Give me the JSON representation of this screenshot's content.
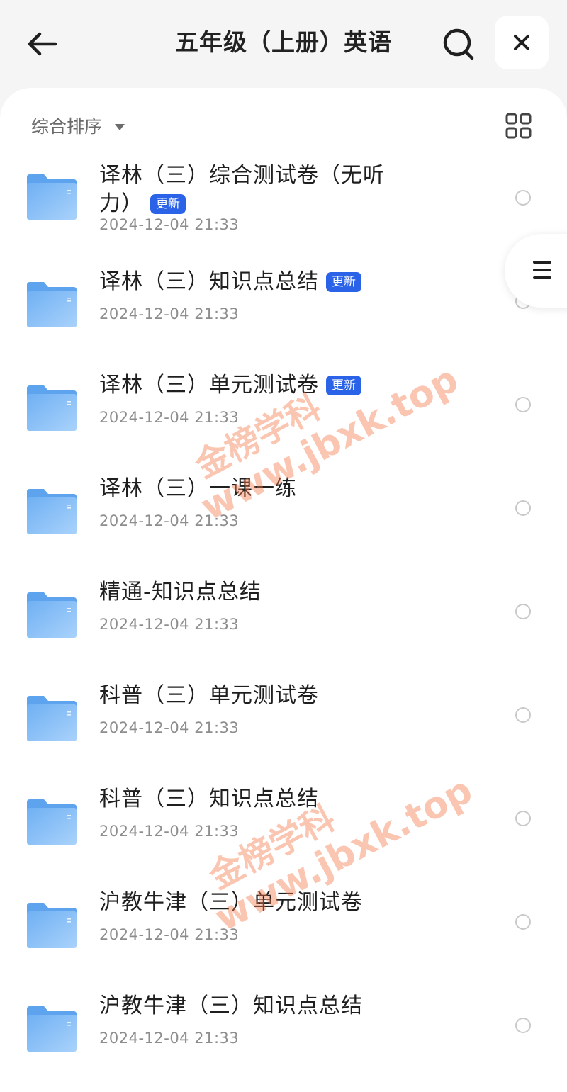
{
  "header": {
    "title": "五年级（上册）英语"
  },
  "toolbar": {
    "sort_label": "综合排序"
  },
  "items": [
    {
      "title": "译林（三）综合测试卷（无听力）",
      "badge": "更新",
      "date": "2024-12-04 21:33"
    },
    {
      "title": "译林（三）知识点总结",
      "badge": "更新",
      "date": "2024-12-04 21:33"
    },
    {
      "title": "译林（三）单元测试卷",
      "badge": "更新",
      "date": "2024-12-04 21:33"
    },
    {
      "title": "译林（三）一课一练",
      "badge": "",
      "date": "2024-12-04 21:33"
    },
    {
      "title": "精通-知识点总结",
      "badge": "",
      "date": "2024-12-04 21:33"
    },
    {
      "title": "科普（三）单元测试卷",
      "badge": "",
      "date": "2024-12-04 21:33"
    },
    {
      "title": "科普（三）知识点总结",
      "badge": "",
      "date": "2024-12-04 21:33"
    },
    {
      "title": "沪教牛津（三）单元测试卷",
      "badge": "",
      "date": "2024-12-04 21:33"
    },
    {
      "title": "沪教牛津（三）知识点总结",
      "badge": "",
      "date": "2024-12-04 21:33"
    }
  ],
  "watermarks": [
    {
      "line1": "金榜学科",
      "line2": "www.jbxk.top"
    },
    {
      "line1": "金榜学科",
      "line2": "www.jbxk.top"
    }
  ],
  "icons": {
    "back": "arrow-left-icon",
    "search": "search-icon",
    "close": "close-icon",
    "grid": "grid-view-icon",
    "menu": "menu-icon",
    "folder": "folder-icon"
  },
  "colors": {
    "badge": "#2a62e8",
    "folder": "#7db8f5",
    "watermark": "#f57846"
  }
}
